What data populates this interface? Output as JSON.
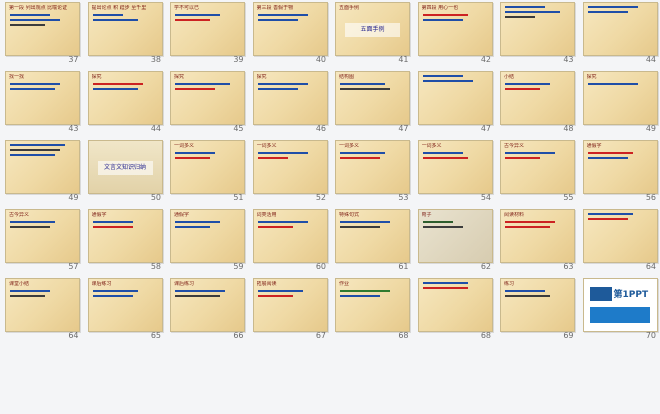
{
  "sorter": {
    "slides": [
      {
        "number": "37",
        "label": "第一段 列出观点 比喻论证"
      },
      {
        "number": "38",
        "label": "提出论点 积 跬步 至千里"
      },
      {
        "number": "39",
        "label": "学不可以已"
      },
      {
        "number": "40",
        "label": "第三段 善假于物"
      },
      {
        "number": "41",
        "label": "五面手例"
      },
      {
        "number": "42",
        "label": "第四段 用心一也"
      },
      {
        "number": "43",
        "label": "找一找"
      },
      {
        "number": "44",
        "label": "探究"
      },
      {
        "number": "45",
        "label": "探究"
      },
      {
        "number": "46",
        "label": "探究"
      },
      {
        "number": "47",
        "label": "结构图"
      },
      {
        "number": "48",
        "label": "小结"
      },
      {
        "number": "49",
        "label": "探究"
      },
      {
        "number": "50",
        "label": "文言文知识归纳"
      },
      {
        "number": "51",
        "label": "一词多义"
      },
      {
        "number": "52",
        "label": "一词多义"
      },
      {
        "number": "53",
        "label": "一词多义"
      },
      {
        "number": "54",
        "label": "一词多义"
      },
      {
        "number": "55",
        "label": "古今异义"
      },
      {
        "number": "56",
        "label": "通假字"
      },
      {
        "number": "57",
        "label": "古今异义"
      },
      {
        "number": "58",
        "label": "通假字"
      },
      {
        "number": "59",
        "label": "通假字"
      },
      {
        "number": "60",
        "label": "词类活用"
      },
      {
        "number": "61",
        "label": "特殊句式"
      },
      {
        "number": "62",
        "label": "荀子"
      },
      {
        "number": "63",
        "label": "阅读材料"
      },
      {
        "number": "64",
        "label": "课堂小结"
      },
      {
        "number": "65",
        "label": "课后练习"
      },
      {
        "number": "66",
        "label": "课后练习"
      },
      {
        "number": "67",
        "label": "拓展阅读"
      },
      {
        "number": "68",
        "label": "作业"
      },
      {
        "number": "69",
        "label": "练习"
      },
      {
        "number": "70",
        "label": "第1PPT"
      }
    ],
    "slide50_title": "文言文知识归纳",
    "slide41_title": "五面手例",
    "slide70_title": "第1PPT"
  }
}
